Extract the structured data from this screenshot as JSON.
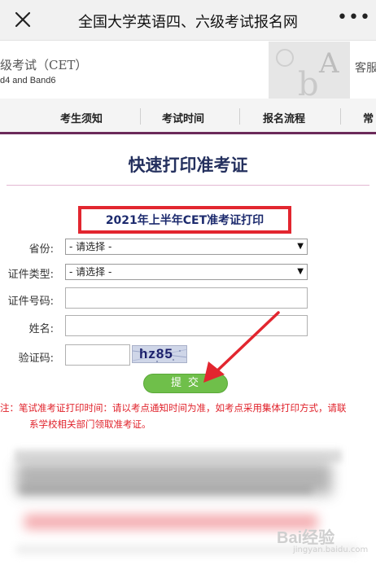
{
  "app_bar": {
    "close_icon": "close-icon",
    "title": "全国大学英语四、六级考试报名网",
    "more_icon": "more-icon",
    "more_label": "•••"
  },
  "banner": {
    "exam_title": "级考试（CET）",
    "exam_subtitle": "d4 and Band6",
    "right_text": "客服"
  },
  "nav": {
    "items": [
      "考生须知",
      "考试时间",
      "报名流程",
      "常"
    ]
  },
  "page": {
    "title": "快速打印准考证",
    "heading": "2021年上半年CET准考证打印"
  },
  "form": {
    "province_label": "省份:",
    "province_value": "- 请选择 -",
    "id_type_label": "证件类型:",
    "id_type_value": "- 请选择 -",
    "id_number_label": "证件号码:",
    "id_number_value": "",
    "name_label": "姓名:",
    "name_value": "",
    "captcha_label": "验证码:",
    "captcha_value": "",
    "captcha_text": "hz85",
    "submit_label": "提交"
  },
  "note": {
    "line1": "注：笔试准考证打印时间：请以考点通知时间为准，如考点采用集体打印方式，请联",
    "line2": "系学校相关部门领取准考证。"
  },
  "watermark": {
    "logo": "Bai经验",
    "sub": "jingyan.baidu.com"
  },
  "colors": {
    "highlight_border": "#e2262f",
    "title_blue": "#24305e",
    "submit_green": "#6fbf4a",
    "note_red": "#e0212a",
    "nav_underline": "#6b2a5a",
    "arrow_red": "#e2262f"
  }
}
